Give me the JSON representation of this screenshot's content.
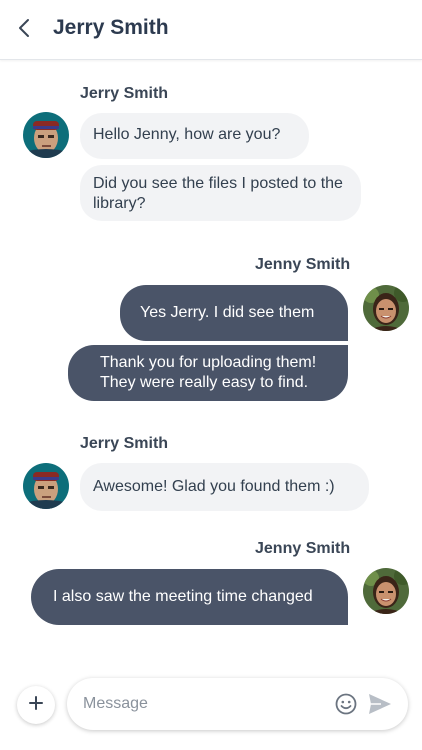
{
  "header": {
    "title": "Jerry Smith",
    "back_icon": "chevron-left-icon"
  },
  "messages": [
    {
      "sender": "Jerry Smith",
      "direction": "incoming",
      "texts": [
        "Hello Jenny, how are you?",
        "Did you see the files I posted to the library?"
      ]
    },
    {
      "sender": "Jenny Smith",
      "direction": "outgoing",
      "texts": [
        "Yes Jerry.  I did see them",
        "Thank you for uploading them! They were really easy to find."
      ]
    },
    {
      "sender": "Jerry Smith",
      "direction": "incoming",
      "texts": [
        "Awesome!  Glad you found them :)"
      ]
    },
    {
      "sender": "Jenny Smith",
      "direction": "outgoing",
      "texts": [
        "I also saw the meeting time changed"
      ]
    }
  ],
  "composer": {
    "placeholder": "Message",
    "add_icon": "plus-icon",
    "emoji_icon": "smiley-icon",
    "send_icon": "send-icon"
  },
  "colors": {
    "outgoing_bubble": "#4a5468",
    "incoming_bubble": "#f2f3f5",
    "title_text": "#2c3a4f"
  }
}
